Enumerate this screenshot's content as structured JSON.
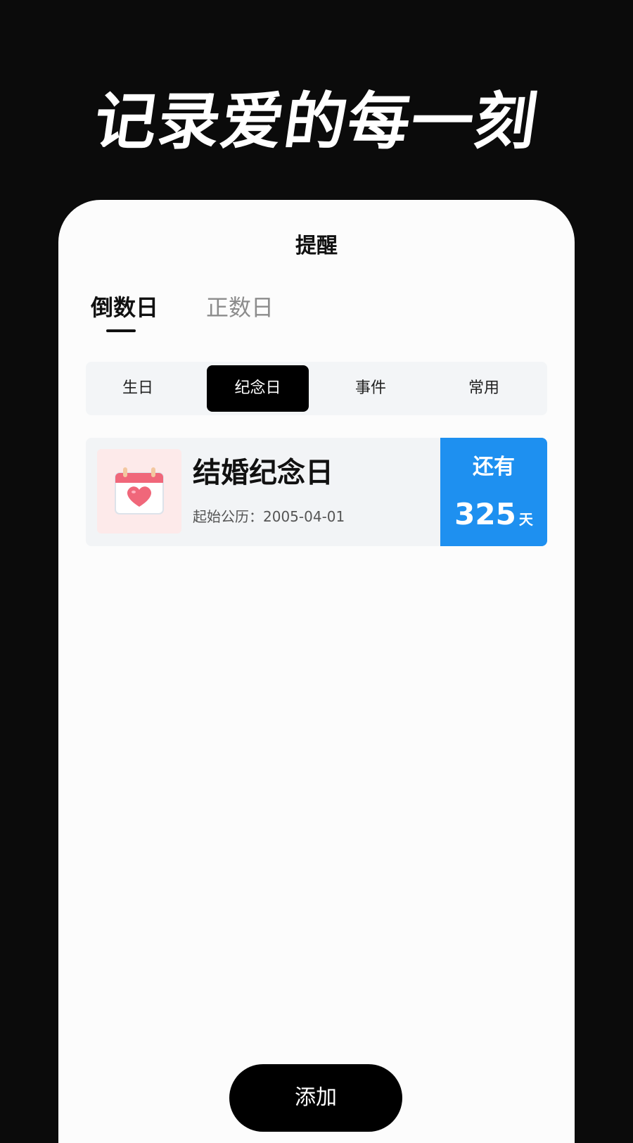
{
  "hero": {
    "title": "记录爱的每一刻"
  },
  "header": {
    "title": "提醒"
  },
  "tabs": [
    {
      "label": "倒数日",
      "active": true
    },
    {
      "label": "正数日",
      "active": false
    }
  ],
  "segments": [
    {
      "label": "生日",
      "selected": false
    },
    {
      "label": "纪念日",
      "selected": true
    },
    {
      "label": "事件",
      "selected": false
    },
    {
      "label": "常用",
      "selected": false
    }
  ],
  "events": [
    {
      "icon": "calendar-heart-icon",
      "name": "结婚纪念日",
      "date_text": "起始公历：2005-04-01",
      "countdown_label": "还有",
      "countdown_value": "325",
      "countdown_unit": "天"
    }
  ],
  "actions": {
    "add_label": "添加"
  },
  "colors": {
    "background": "#0b0b0b",
    "panel": "#fcfcfc",
    "accent": "#1e90f0",
    "selected": "#000000",
    "icon_bg": "#fdeaea",
    "heart": "#f0677a"
  }
}
